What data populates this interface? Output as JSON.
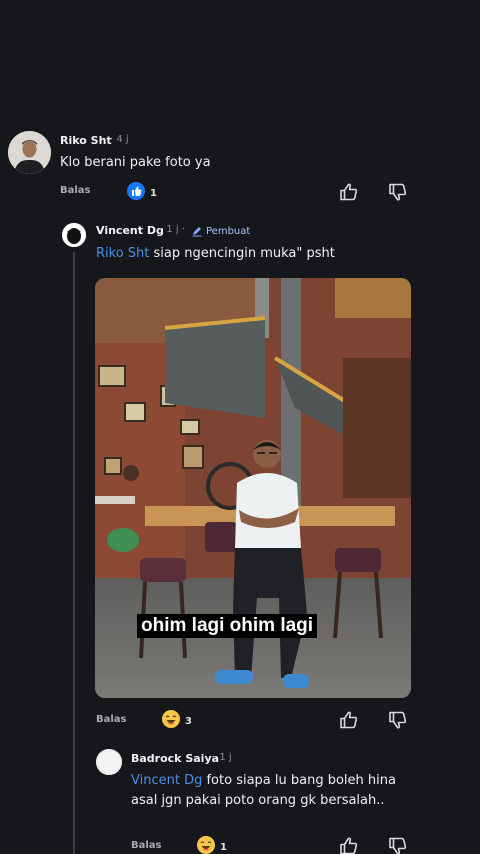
{
  "comments": [
    {
      "author": "Riko Sht",
      "time": "· 4 j",
      "text": "Klo berani pake foto ya",
      "reply_label": "Balas",
      "reaction_count": "1"
    },
    {
      "author": "Vincent Dg",
      "time": "· 1 j ·",
      "creator_label": "Pembuat",
      "mention": "Riko Sht",
      "text": "siap ngencingin muka\" psht",
      "image_caption": "ohim lagi ohim lagi",
      "reply_label": "Balas",
      "reaction_count": "3"
    },
    {
      "author": "Badrock Saiya",
      "time": "· 1 j",
      "mention": "Vincent Dg",
      "text": "foto siapa lu bang boleh hina asal jgn pakai poto orang gk bersalah..",
      "reply_label": "Balas",
      "reaction_count": "1"
    }
  ],
  "icons": {
    "like": "thumbs-up-icon",
    "dislike": "thumbs-down-icon",
    "reaction_like": "blue-like-reaction-icon",
    "reaction_haha": "laughing-emoji-icon",
    "creator": "pencil-icon"
  },
  "colors": {
    "background": "#15171b",
    "mention": "#4d8fe6",
    "like_reaction": "#1877f2"
  }
}
